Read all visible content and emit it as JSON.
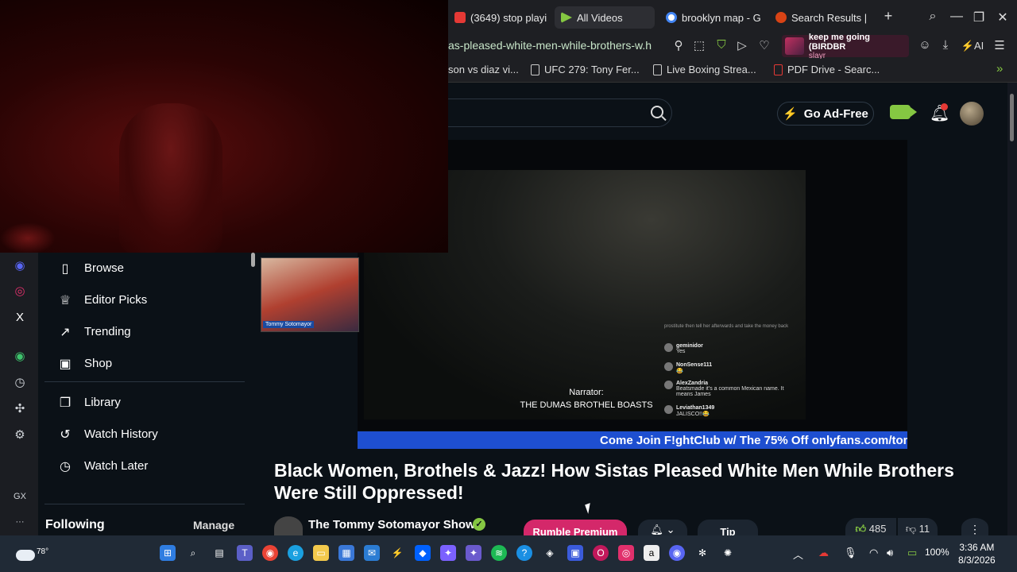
{
  "browser": {
    "tabs": [
      {
        "label": "(3649) stop playi",
        "icon_color": "#e53935",
        "active": false
      },
      {
        "label": "All Videos",
        "icon_color": "#85c742",
        "active": true
      },
      {
        "label": "brooklyn map - G",
        "icon_color": "#4285f4",
        "active": false
      },
      {
        "label": "Search Results |",
        "icon_color": "#d84315",
        "active": false
      }
    ],
    "new_tab": "+",
    "url": "as-pleased-white-men-while-brothers-w.h",
    "music": {
      "title": "keep me going (BIRDBR",
      "artist": "slayr"
    },
    "ai_label": "AI",
    "bookmarks": [
      "son vs diaz vi...",
      "UFC 279: Tony Fer...",
      "Live Boxing Strea...",
      "PDF Drive - Searc..."
    ]
  },
  "header": {
    "go_ad_free": "Go Ad-Free"
  },
  "nav": {
    "items": [
      {
        "label": "Browse",
        "icon": "browse-icon",
        "glyph": "▯"
      },
      {
        "label": "Editor Picks",
        "icon": "award-icon",
        "glyph": "♕"
      },
      {
        "label": "Trending",
        "icon": "trending-icon",
        "glyph": "↗"
      },
      {
        "label": "Shop",
        "icon": "shop-icon",
        "glyph": "▣"
      },
      {
        "label": "Library",
        "icon": "library-icon",
        "glyph": "❐"
      },
      {
        "label": "Watch History",
        "icon": "history-icon",
        "glyph": "↺"
      },
      {
        "label": "Watch Later",
        "icon": "clock-icon",
        "glyph": "◷"
      }
    ],
    "following": "Following",
    "manage": "Manage"
  },
  "sidebar_icons": [
    {
      "name": "discord-icon",
      "glyph": "◉",
      "color": "#5865f2"
    },
    {
      "name": "instagram-icon",
      "glyph": "◎",
      "color": "#e1306c"
    },
    {
      "name": "x-icon",
      "glyph": "X",
      "color": "#ffffff"
    },
    {
      "name": "player-icon",
      "glyph": "◉",
      "color": "#3ec46d"
    },
    {
      "name": "history-icon",
      "glyph": "◷",
      "color": "#cfd3d8"
    },
    {
      "name": "extensions-icon",
      "glyph": "✣",
      "color": "#cfd3d8"
    },
    {
      "name": "settings-icon",
      "glyph": "⚙",
      "color": "#cfd3d8"
    },
    {
      "name": "gx-icon",
      "glyph": "GX",
      "color": "#cfd3d8"
    },
    {
      "name": "more-icon",
      "glyph": "···",
      "color": "#cfd3d8"
    }
  ],
  "video": {
    "caption_line1": "Narrator:",
    "caption_line2": "THE DUMAS BROTHEL BOASTS",
    "thumb_label": "Tommy Sotomayor",
    "ticker": "Come Join F!ghtClub w/ The 75% Off onlyfans.com/tom",
    "chat_header": "prostitute then tell her afterwards and take the money back",
    "chat": [
      {
        "name": "geminidor",
        "text": "Yes"
      },
      {
        "name": "NonSense111",
        "text": "😂"
      },
      {
        "name": "AlexZandria",
        "text": "Beatsmade it's a common Mexican name. It means James"
      },
      {
        "name": "Leviathan1349",
        "text": "JALISCO!!😂"
      }
    ],
    "title": "Black Women, Brothels & Jazz! How Sistas Pleased White Men While Brothers Were Still Oppressed!",
    "channel": "The Tommy Sotomayor Show",
    "premium": "Rumble Premium",
    "tip": "Tip",
    "likes": "485",
    "dislikes": "11"
  },
  "taskbar": {
    "temperature": "78°",
    "battery": "100%",
    "time": "3:36 AM",
    "date": "8/3/2026"
  }
}
